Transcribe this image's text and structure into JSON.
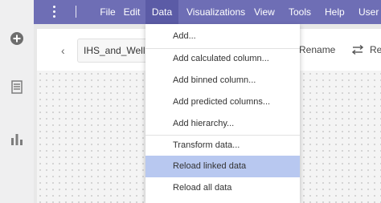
{
  "menubar": {
    "items": [
      {
        "label": "File"
      },
      {
        "label": "Edit"
      },
      {
        "label": "Data"
      },
      {
        "label": "Visualizations"
      },
      {
        "label": "View"
      },
      {
        "label": "Tools"
      },
      {
        "label": "Help"
      },
      {
        "label": "User"
      }
    ]
  },
  "tab": {
    "title": "IHS_and_WellHe"
  },
  "toolbar": {
    "rename": "Rename",
    "re": "Re"
  },
  "dropdown": {
    "items": [
      {
        "label": "Add..."
      },
      {
        "label": "Add calculated column..."
      },
      {
        "label": "Add binned column..."
      },
      {
        "label": "Add predicted columns..."
      },
      {
        "label": "Add hierarchy..."
      },
      {
        "label": "Transform data..."
      },
      {
        "label": "Reload linked data"
      },
      {
        "label": "Reload all data"
      }
    ]
  },
  "colors": {
    "menubar": "#6e6eb5",
    "menubar_active": "#5b5ba6",
    "highlight": "#b8c8f0"
  },
  "icons": {
    "rail": [
      "plus-circle-icon",
      "document-icon",
      "bar-chart-icon"
    ],
    "kebab": "kebab-menu-icon",
    "back": "chevron-left-icon",
    "re": "swap-icon"
  }
}
